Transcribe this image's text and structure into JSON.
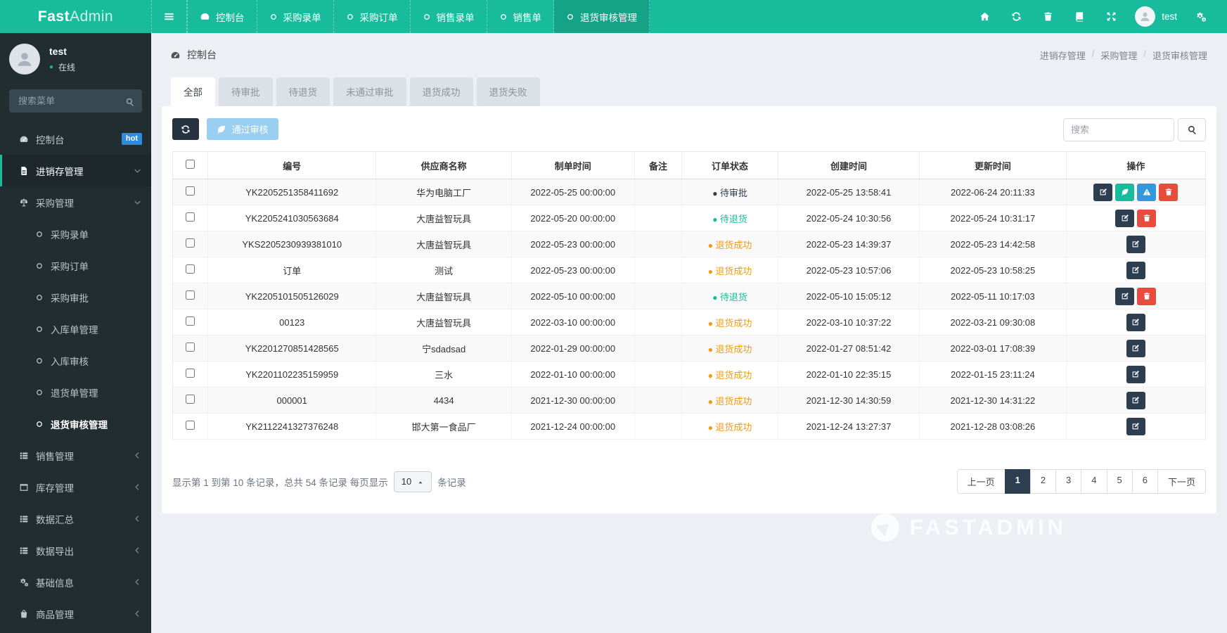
{
  "topbar": {
    "logo_bold": "Fast",
    "logo_light": "Admin",
    "tabs": [
      {
        "label": "控制台",
        "icon": "gauge",
        "active": false
      },
      {
        "label": "采购录单",
        "icon": "circle",
        "active": false
      },
      {
        "label": "采购订单",
        "icon": "circle",
        "active": false
      },
      {
        "label": "销售录单",
        "icon": "circle",
        "active": false
      },
      {
        "label": "销售单",
        "icon": "circle",
        "active": false
      },
      {
        "label": "退货审核管理",
        "icon": "circle",
        "active": true
      }
    ],
    "right_icons": [
      {
        "icon": "home",
        "name": "home-button"
      },
      {
        "icon": "refresh",
        "name": "refresh-button"
      },
      {
        "icon": "trash",
        "name": "clear-cache-button"
      },
      {
        "icon": "docs",
        "name": "docs-button"
      },
      {
        "icon": "expand",
        "name": "fullscreen-button"
      }
    ],
    "username": "test"
  },
  "sidebar": {
    "user": {
      "name": "test",
      "status": "在线"
    },
    "search_placeholder": "搜索菜单",
    "menu": [
      {
        "label": "控制台",
        "icon": "gauge",
        "badge": "hot",
        "level": 1
      },
      {
        "label": "进销存管理",
        "icon": "file",
        "arrow": "down",
        "level": 1,
        "open": true
      },
      {
        "label": "采购管理",
        "icon": "balance",
        "arrow": "down",
        "level": 2
      },
      {
        "label": "采购录单",
        "icon": "circle",
        "level": 3
      },
      {
        "label": "采购订单",
        "icon": "circle",
        "level": 3
      },
      {
        "label": "采购审批",
        "icon": "circle",
        "level": 3
      },
      {
        "label": "入库单管理",
        "icon": "circle",
        "level": 3
      },
      {
        "label": "入库审核",
        "icon": "circle",
        "level": 3
      },
      {
        "label": "退货单管理",
        "icon": "circle",
        "level": 3
      },
      {
        "label": "退货审核管理",
        "icon": "circle",
        "level": 3,
        "current": true
      },
      {
        "label": "销售管理",
        "icon": "list",
        "arrow": "left",
        "level": 2
      },
      {
        "label": "库存管理",
        "icon": "window",
        "arrow": "left",
        "level": 2
      },
      {
        "label": "数据汇总",
        "icon": "list",
        "arrow": "left",
        "level": 2
      },
      {
        "label": "数据导出",
        "icon": "list",
        "arrow": "left",
        "level": 2
      },
      {
        "label": "基础信息",
        "icon": "cogs",
        "arrow": "left",
        "level": 2
      },
      {
        "label": "商品管理",
        "icon": "bag",
        "arrow": "left",
        "level": 2
      }
    ]
  },
  "content": {
    "header_left": "控制台",
    "breadcrumb": [
      "进销存管理",
      "采购管理",
      "退货审核管理"
    ],
    "filter_tabs": [
      {
        "label": "全部",
        "active": true
      },
      {
        "label": "待审批",
        "active": false
      },
      {
        "label": "待退货",
        "active": false
      },
      {
        "label": "未通过审批",
        "active": false
      },
      {
        "label": "退货成功",
        "active": false
      },
      {
        "label": "退货失败",
        "active": false
      }
    ],
    "toolbar": {
      "approve": "通过审核",
      "search_placeholder": "搜索"
    },
    "table": {
      "headers": [
        "编号",
        "供应商名称",
        "制单时间",
        "备注",
        "订单状态",
        "创建时间",
        "更新时间",
        "操作"
      ],
      "rows": [
        {
          "no": "YK2205251358411692",
          "supplier": "华为电脑工厂",
          "made_at": "2022-05-25 00:00:00",
          "remark": "",
          "status": "待审批",
          "status_color": "dark",
          "created_at": "2022-05-25 13:58:41",
          "updated_at": "2022-06-24 20:11:33",
          "actions": [
            "edit",
            "leaf",
            "warn",
            "trash"
          ]
        },
        {
          "no": "YK2205241030563684",
          "supplier": "大唐益智玩具",
          "made_at": "2022-05-20 00:00:00",
          "remark": "",
          "status": "待退货",
          "status_color": "teal",
          "created_at": "2022-05-24 10:30:56",
          "updated_at": "2022-05-24 10:31:17",
          "actions": [
            "edit",
            "trash"
          ]
        },
        {
          "no": "YKS2205230939381010",
          "supplier": "大唐益智玩具",
          "made_at": "2022-05-23 00:00:00",
          "remark": "",
          "status": "退货成功",
          "status_color": "orange",
          "created_at": "2022-05-23 14:39:37",
          "updated_at": "2022-05-23 14:42:58",
          "actions": [
            "edit"
          ]
        },
        {
          "no": "订单",
          "supplier": "测试",
          "made_at": "2022-05-23 00:00:00",
          "remark": "",
          "status": "退货成功",
          "status_color": "orange",
          "created_at": "2022-05-23 10:57:06",
          "updated_at": "2022-05-23 10:58:25",
          "actions": [
            "edit"
          ]
        },
        {
          "no": "YK2205101505126029",
          "supplier": "大唐益智玩具",
          "made_at": "2022-05-10 00:00:00",
          "remark": "",
          "status": "待退货",
          "status_color": "teal",
          "created_at": "2022-05-10 15:05:12",
          "updated_at": "2022-05-11 10:17:03",
          "actions": [
            "edit",
            "trash"
          ]
        },
        {
          "no": "00123",
          "supplier": "大唐益智玩具",
          "made_at": "2022-03-10 00:00:00",
          "remark": "",
          "status": "退货成功",
          "status_color": "orange",
          "created_at": "2022-03-10 10:37:22",
          "updated_at": "2022-03-21 09:30:08",
          "actions": [
            "edit"
          ]
        },
        {
          "no": "YK2201270851428565",
          "supplier": "宁sdadsad",
          "made_at": "2022-01-29 00:00:00",
          "remark": "",
          "status": "退货成功",
          "status_color": "orange",
          "created_at": "2022-01-27 08:51:42",
          "updated_at": "2022-03-01 17:08:39",
          "actions": [
            "edit"
          ]
        },
        {
          "no": "YK2201102235159959",
          "supplier": "三水",
          "made_at": "2022-01-10 00:00:00",
          "remark": "",
          "status": "退货成功",
          "status_color": "orange",
          "created_at": "2022-01-10 22:35:15",
          "updated_at": "2022-01-15 23:11:24",
          "actions": [
            "edit"
          ]
        },
        {
          "no": "000001",
          "supplier": "4434",
          "made_at": "2021-12-30 00:00:00",
          "remark": "",
          "status": "退货成功",
          "status_color": "orange",
          "created_at": "2021-12-30 14:30:59",
          "updated_at": "2021-12-30 14:31:22",
          "actions": [
            "edit"
          ]
        },
        {
          "no": "YK2112241327376248",
          "supplier": "邯大第一食品厂",
          "made_at": "2021-12-24 00:00:00",
          "remark": "",
          "status": "退货成功",
          "status_color": "orange",
          "created_at": "2021-12-24 13:27:37",
          "updated_at": "2021-12-28 03:08:26",
          "actions": [
            "edit"
          ]
        }
      ]
    },
    "footer": {
      "info_before": "显示第 1 到第 10 条记录，总共 54 条记录 每页显示",
      "page_size": "10",
      "info_after": "条记录",
      "pages": [
        "上一页",
        "1",
        "2",
        "3",
        "4",
        "5",
        "6",
        "下一页"
      ],
      "active_page": "1"
    }
  },
  "watermark": "FASTADMIN",
  "colors": {
    "topbar": "#18bc9c",
    "sidebar": "#222d32",
    "accent": "#18bc9c",
    "hot_badge": "#2f8be0",
    "btn_dark": "#2c3e50",
    "btn_info": "#3498db",
    "btn_danger": "#e74c3c",
    "status_orange": "#f39c12",
    "page_bg": "#ecf0f5"
  }
}
